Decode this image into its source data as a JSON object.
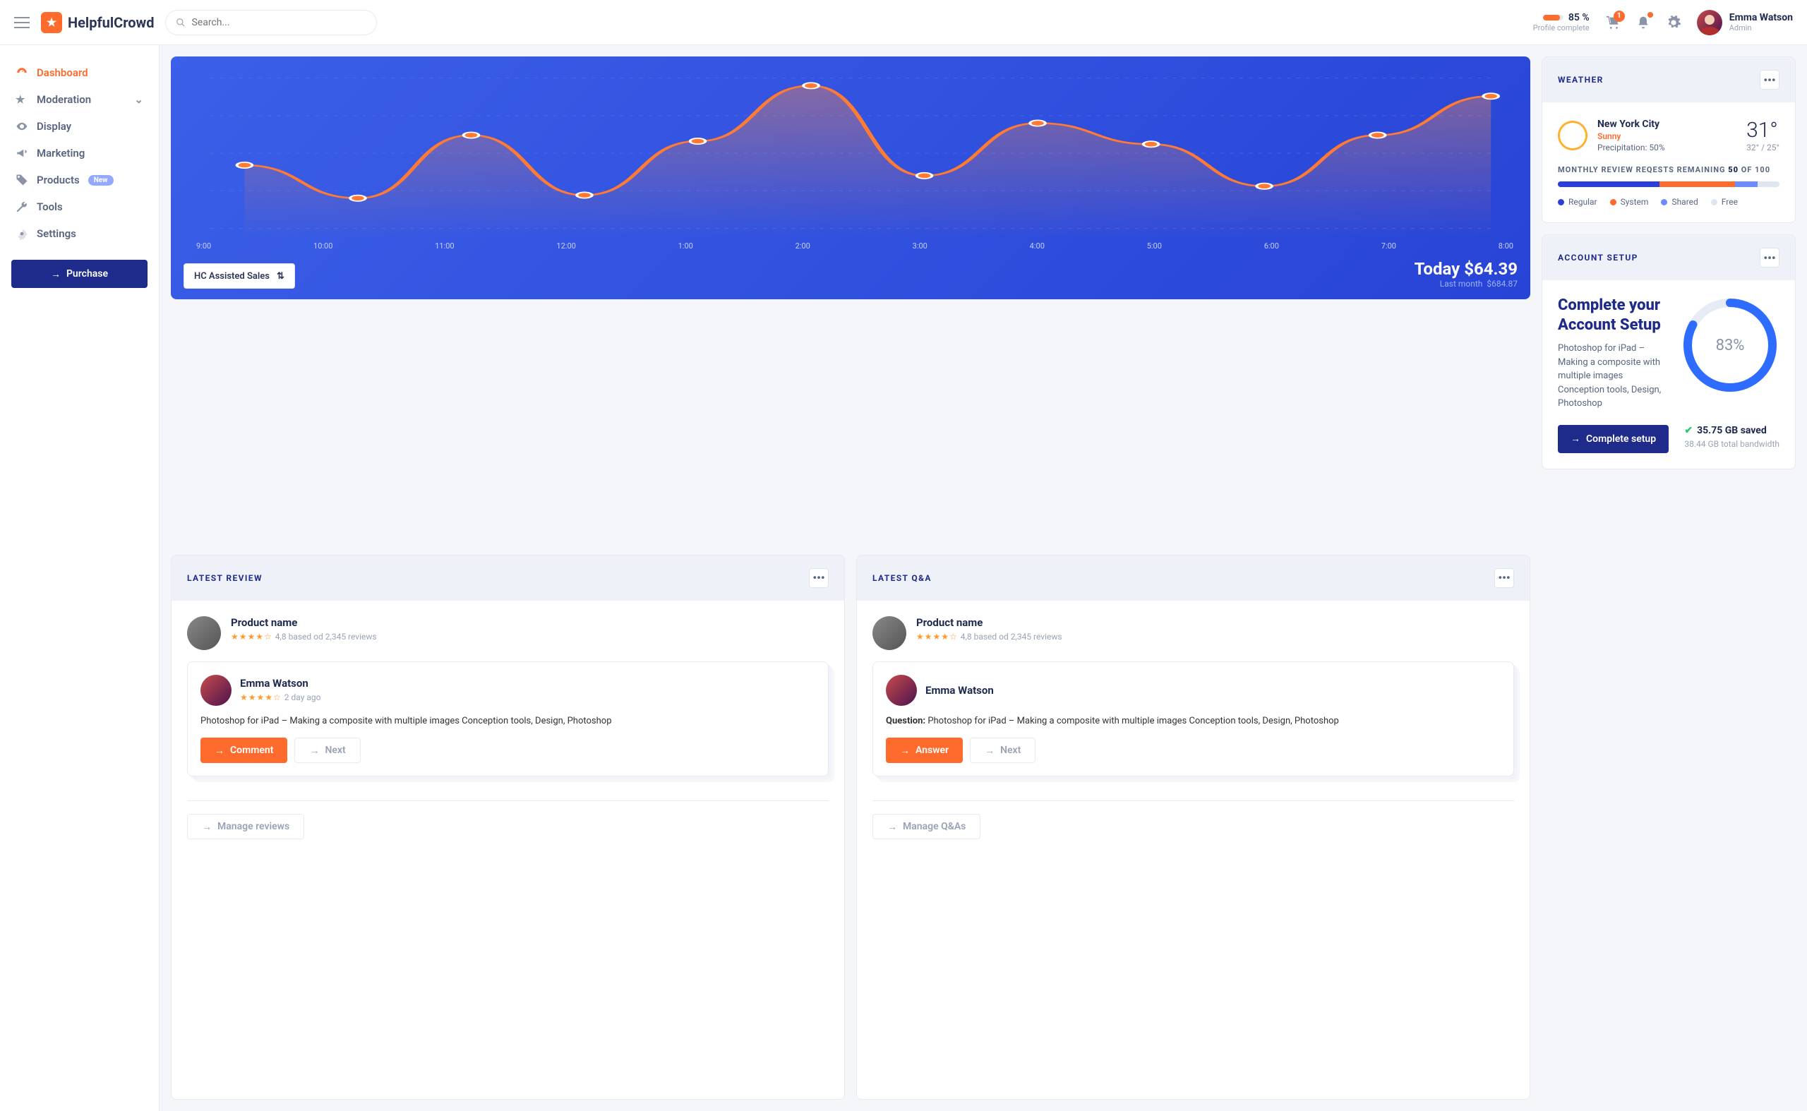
{
  "header": {
    "brand": "HelpfulCrowd",
    "search_placeholder": "Search...",
    "profile_pct": "85 %",
    "profile_label": "Profile complete",
    "cart_badge": "1",
    "user_name": "Emma Watson",
    "user_role": "Admin"
  },
  "sidebar": {
    "items": [
      {
        "label": "Dashboard"
      },
      {
        "label": "Moderation"
      },
      {
        "label": "Display"
      },
      {
        "label": "Marketing"
      },
      {
        "label": "Products"
      },
      {
        "label": "Tools"
      },
      {
        "label": "Settings"
      }
    ],
    "products_pill": "New",
    "purchase": "Purchase"
  },
  "chart_data": {
    "type": "line",
    "x": [
      "9:00",
      "10:00",
      "11:00",
      "12:00",
      "1:00",
      "2:00",
      "3:00",
      "4:00",
      "5:00",
      "6:00",
      "7:00",
      "8:00"
    ],
    "values": [
      42,
      20,
      62,
      22,
      58,
      95,
      35,
      70,
      56,
      28,
      62,
      88
    ],
    "ylim": [
      0,
      100
    ],
    "selector_label": "HC Assisted Sales",
    "today_label": "Today",
    "today_value": "$64.39",
    "last_label": "Last month",
    "last_value": "$684.87"
  },
  "weather": {
    "title": "WEATHER",
    "city": "New York City",
    "condition": "Sunny",
    "precip": "Precipitation: 50%",
    "temp": "31°",
    "range": "32° / 25°"
  },
  "review_requests": {
    "title_pre": "MONTHLY REVIEW REQESTS REMAINING",
    "count": "50",
    "title_post": "OF 100",
    "segments": [
      {
        "label": "Regular",
        "color": "#2a3edb",
        "pct": 46
      },
      {
        "label": "System",
        "color": "#ff6b2c",
        "pct": 34
      },
      {
        "label": "Shared",
        "color": "#6d8bff",
        "pct": 10
      },
      {
        "label": "Free",
        "color": "#e0e6f0",
        "pct": 10
      }
    ]
  },
  "account": {
    "title": "ACCOUNT SETUP",
    "heading": "Complete your Account Setup",
    "desc": "Photoshop for iPad – Making a composite with multiple images Conception tools, Design, Photoshop",
    "pct": "83%",
    "pct_num": 83,
    "button": "Complete setup",
    "saved": "35.75 GB saved",
    "bandwidth": "38.44 GB total bandwidth"
  },
  "latest_review": {
    "title": "LATEST REVIEW",
    "product": "Product name",
    "rating_text": "4,8 based od 2,345 reviews",
    "reviewer": "Emma Watson",
    "time": "2 day ago",
    "body": "Photoshop for iPad – Making a composite with multiple images Conception tools, Design, Photoshop",
    "primary": "Comment",
    "secondary": "Next",
    "manage": "Manage reviews"
  },
  "latest_qa": {
    "title": "LATEST Q&A",
    "product": "Product name",
    "rating_text": "4,8 based od 2,345 reviews",
    "reviewer": "Emma Watson",
    "q_label": "Question:",
    "body": "Photoshop for iPad – Making a composite with multiple images Conception tools, Design, Photoshop",
    "primary": "Answer",
    "secondary": "Next",
    "manage": "Manage Q&As"
  }
}
